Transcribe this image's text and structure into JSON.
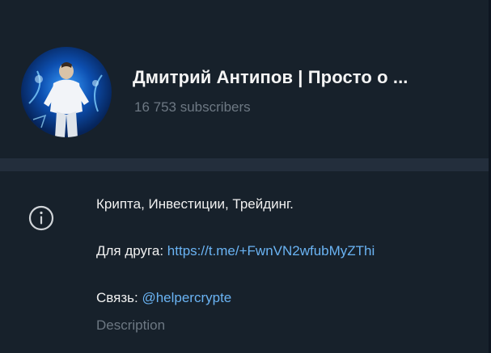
{
  "channel": {
    "name": "Дмитрий Антипов | Просто о ...",
    "subscribers": "16 753 subscribers"
  },
  "info": {
    "icon": "info-icon",
    "line1": "Крипта, Инвестиции, Трейдинг.",
    "friend_label": "Для друга:",
    "friend_link": "https://t.me/+FwnVN2wfubMyZThi",
    "contact_label": "Связь:",
    "contact_link": "@helpercrypte",
    "description_label": "Description"
  },
  "colors": {
    "background": "#17212b",
    "divider": "#232e3c",
    "link": "#6ab3f3",
    "muted": "#6d7883"
  }
}
